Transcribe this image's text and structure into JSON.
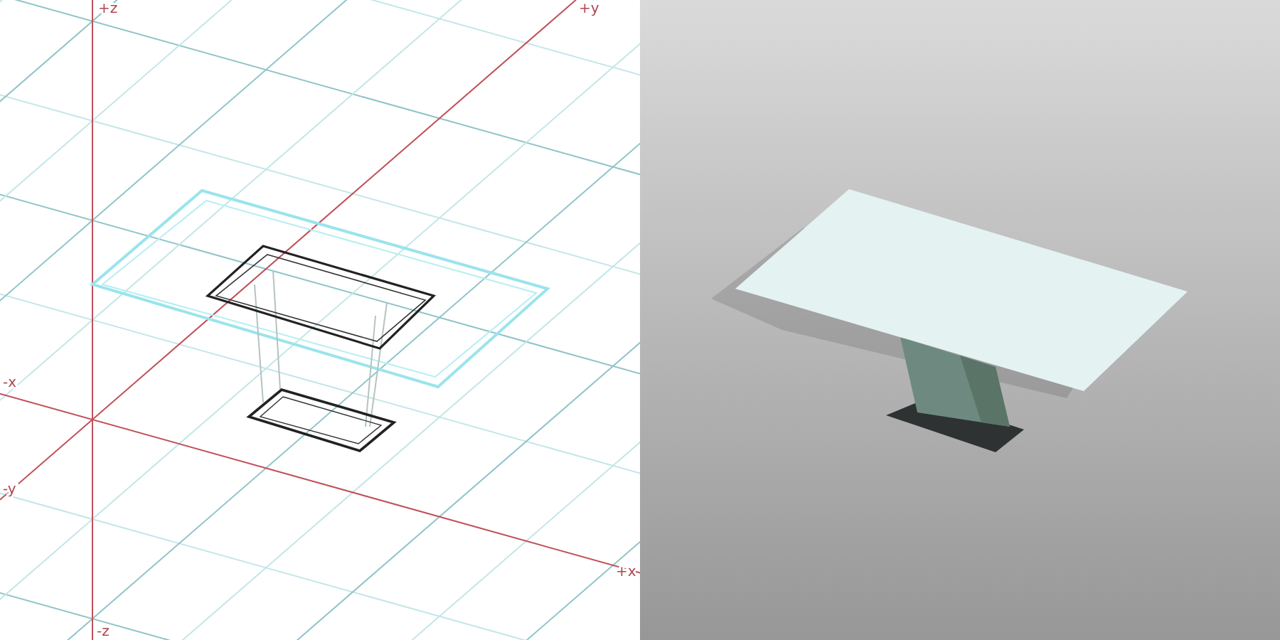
{
  "viewports": [
    {
      "kind": "wireframe",
      "axes": {
        "pos_z": "+z",
        "pos_y": "+y",
        "neg_x": "-x",
        "neg_y": "-y",
        "pos_x": "+x",
        "neg_z": "-z"
      }
    },
    {
      "kind": "render"
    }
  ]
}
